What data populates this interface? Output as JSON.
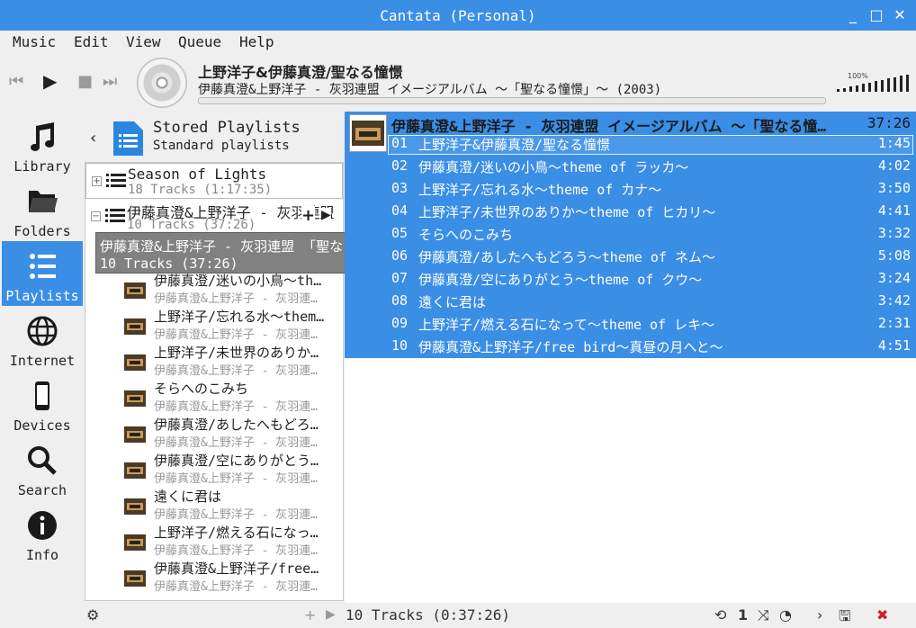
{
  "window": {
    "title": "Cantata (Personal)"
  },
  "menu": [
    "Music",
    "Edit",
    "View",
    "Queue",
    "Help"
  ],
  "now_playing": {
    "title": "上野洋子&伊藤真澄/聖なる憧憬",
    "subtitle": "伊藤真澄&上野洋子 - 灰羽連盟 イメージアルバム 〜「聖なる憧憬」〜 (2003)",
    "progress": 0,
    "volume_label": "100%",
    "volume": 1.0
  },
  "sidebar": [
    {
      "label": "Library",
      "icon": "music-note-icon"
    },
    {
      "label": "Folders",
      "icon": "folder-icon"
    },
    {
      "label": "Playlists",
      "icon": "list-icon",
      "active": true
    },
    {
      "label": "Internet",
      "icon": "globe-icon"
    },
    {
      "label": "Devices",
      "icon": "phone-icon"
    },
    {
      "label": "Search",
      "icon": "magnifier-icon"
    },
    {
      "label": "Info",
      "icon": "info-icon"
    }
  ],
  "playlists_panel": {
    "title": "Stored Playlists",
    "subtitle": "Standard playlists",
    "playlists": [
      {
        "name": "Season of Lights",
        "count": "18 Tracks (1:17:35)"
      },
      {
        "name": "伊藤真澄&上野洋子 - 灰羽連盟",
        "count": "10 Tracks (37:26)"
      }
    ],
    "tracks": [
      {
        "title": "伊藤真澄/迷いの小鳥〜th…",
        "artist": "伊藤真澄&上野洋子 - 灰羽連…"
      },
      {
        "title": "上野洋子/忘れる水〜them…",
        "artist": "伊藤真澄&上野洋子 - 灰羽連…"
      },
      {
        "title": "上野洋子/未世界のありか…",
        "artist": "伊藤真澄&上野洋子 - 灰羽連…"
      },
      {
        "title": "そらへのこみち",
        "artist": "伊藤真澄&上野洋子 - 灰羽連…"
      },
      {
        "title": "伊藤真澄/あしたへもどろ…",
        "artist": "伊藤真澄&上野洋子 - 灰羽連…"
      },
      {
        "title": "伊藤真澄/空にありがとう…",
        "artist": "伊藤真澄&上野洋子 - 灰羽連…"
      },
      {
        "title": "遠くに君は",
        "artist": "伊藤真澄&上野洋子 - 灰羽連…"
      },
      {
        "title": "上野洋子/燃える石になっ…",
        "artist": "伊藤真澄&上野洋子 - 灰羽連…"
      },
      {
        "title": "伊藤真澄&上野洋子/free…",
        "artist": "伊藤真澄&上野洋子 - 灰羽連…"
      }
    ],
    "tooltip": {
      "line1": "伊藤真澄&上野洋子 - 灰羽連盟 「聖なる憧憬」",
      "line2": "10 Tracks (37:26)"
    }
  },
  "queue": {
    "album_header": "伊藤真澄&上野洋子 - 灰羽連盟 イメージアルバム 〜「聖なる憧…",
    "album_duration": "37:26",
    "tracks": [
      {
        "no": "01",
        "title": "上野洋子&伊藤真澄/聖なる憧憬",
        "duration": "1:45"
      },
      {
        "no": "02",
        "title": "伊藤真澄/迷いの小鳥〜theme of ラッカ〜",
        "duration": "4:02"
      },
      {
        "no": "03",
        "title": "上野洋子/忘れる水〜theme of カナ〜",
        "duration": "3:50"
      },
      {
        "no": "04",
        "title": "上野洋子/未世界のありか〜theme of ヒカリ〜",
        "duration": "4:41"
      },
      {
        "no": "05",
        "title": "そらへのこみち",
        "duration": "3:32"
      },
      {
        "no": "06",
        "title": "伊藤真澄/あしたへもどろう〜theme of ネム〜",
        "duration": "5:08"
      },
      {
        "no": "07",
        "title": "伊藤真澄/空にありがとう〜theme of クウ〜",
        "duration": "3:24"
      },
      {
        "no": "08",
        "title": "遠くに君は",
        "duration": "3:42"
      },
      {
        "no": "09",
        "title": "上野洋子/燃える石になって〜theme of レキ〜",
        "duration": "2:31"
      },
      {
        "no": "10",
        "title": "伊藤真澄&上野洋子/free bird〜真昼の月へと〜",
        "duration": "4:51"
      }
    ]
  },
  "status": {
    "summary": "10 Tracks (0:37:26)",
    "single_mode": "1"
  },
  "colors": {
    "accent": "#3a8ee6",
    "titlebar": "#3a8ee6",
    "tooltip_bg": "#818181",
    "stop_red": "#cc2222"
  }
}
